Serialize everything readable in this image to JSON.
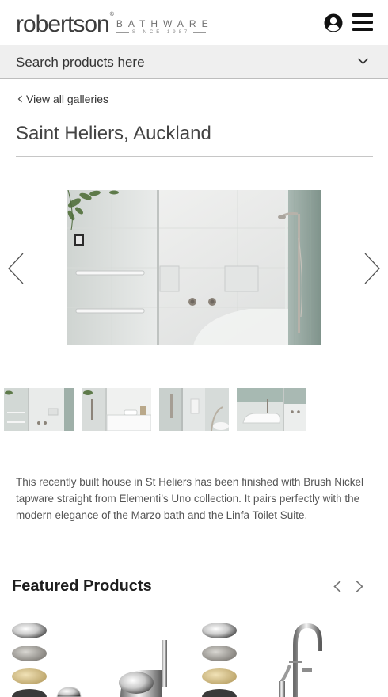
{
  "header": {
    "logo_word": "robertson",
    "logo_reg": "®",
    "logo_sub": "BATHWARE",
    "logo_since": "SINCE 1987",
    "icons": {
      "account": "user-circle-icon",
      "menu": "hamburger-menu-icon"
    }
  },
  "search": {
    "placeholder": "Search products here",
    "icon": "chevron-down-icon"
  },
  "breadcrumb": {
    "back_label": "View all galleries",
    "icon": "chevron-left-icon"
  },
  "gallery": {
    "title": "Saint Heliers, Auckland",
    "prev_icon": "arrow-left-icon",
    "next_icon": "arrow-right-icon",
    "thumbnail_count_visible": 4
  },
  "description": "This recently built house in St Heliers has been finished with Brush Nickel tapware straight from Elementi’s Uno collection. It pairs perfectly with the modern elegance of the Marzo bath and the Linfa Toilet Suite.",
  "featured": {
    "title": "Featured Products",
    "prev_icon": "chevron-left-icon",
    "next_icon": "chevron-right-icon"
  },
  "colors": {
    "search_bg": "#efefef",
    "text": "#2b2b2b",
    "finish_chrome": "#d9d9d9",
    "finish_nickel": "#9a9893",
    "finish_gold": "#d8c28a",
    "finish_black": "#3a3a3a"
  }
}
